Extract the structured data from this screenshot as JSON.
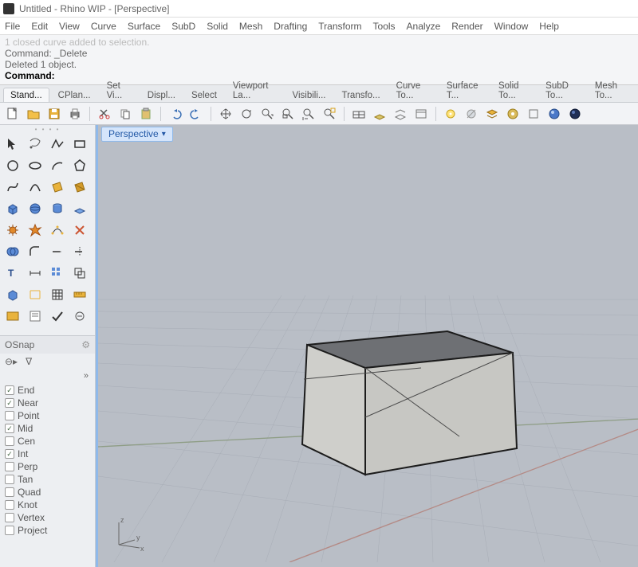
{
  "title": "Untitled - Rhino WIP - [Perspective]",
  "menu": [
    "File",
    "Edit",
    "View",
    "Curve",
    "Surface",
    "SubD",
    "Solid",
    "Mesh",
    "Drafting",
    "Transform",
    "Tools",
    "Analyze",
    "Render",
    "Window",
    "Help"
  ],
  "console": {
    "line1": "1 closed curve added to selection.",
    "line2": "Command: _Delete",
    "line3": "Deleted 1 object.",
    "prompt_label": "Command:",
    "prompt_value": ""
  },
  "toolbar_tabs": [
    {
      "label": "Stand...",
      "active": true
    },
    {
      "label": "CPlan..."
    },
    {
      "label": "Set Vi..."
    },
    {
      "label": "Displ..."
    },
    {
      "label": "Select"
    },
    {
      "label": "Viewport La..."
    },
    {
      "label": "Visibili..."
    },
    {
      "label": "Transfo..."
    },
    {
      "label": "Curve To..."
    },
    {
      "label": "Surface T..."
    },
    {
      "label": "Solid To..."
    },
    {
      "label": "SubD To..."
    },
    {
      "label": "Mesh To..."
    }
  ],
  "osnap": {
    "title": "OSnap",
    "items": [
      {
        "label": "End",
        "checked": true
      },
      {
        "label": "Near",
        "checked": true
      },
      {
        "label": "Point",
        "checked": false
      },
      {
        "label": "Mid",
        "checked": true
      },
      {
        "label": "Cen",
        "checked": false
      },
      {
        "label": "Int",
        "checked": true
      },
      {
        "label": "Perp",
        "checked": false
      },
      {
        "label": "Tan",
        "checked": false
      },
      {
        "label": "Quad",
        "checked": false
      },
      {
        "label": "Knot",
        "checked": false
      },
      {
        "label": "Vertex",
        "checked": false
      },
      {
        "label": "Project",
        "checked": false
      }
    ]
  },
  "viewport": {
    "name": "Perspective",
    "axes": {
      "x": "x",
      "y": "y",
      "z": "z"
    }
  }
}
